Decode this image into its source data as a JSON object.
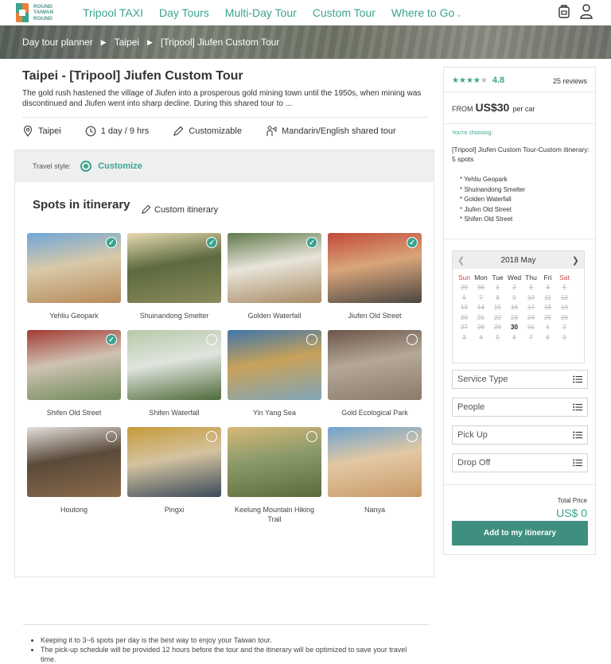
{
  "brand": {
    "logo_lines": [
      "ROUND",
      "TAIWAN",
      "ROUND"
    ]
  },
  "nav": {
    "links": [
      "Tripool TAXI",
      "Day Tours",
      "Multi-Day Tour",
      "Custom Tour",
      "Where to Go"
    ],
    "icons": [
      "backpack-icon",
      "user-icon"
    ]
  },
  "breadcrumb": [
    "Day tour planner",
    "Taipei",
    "[Tripool] Jiufen Custom Tour"
  ],
  "tour": {
    "title": "Taipei - [Tripool] Jiufen Custom Tour",
    "description": "The gold rush hastened the village of Jiufen into a prosperous gold mining town until the 1950s, when mining was discontinued and Jiufen went into sharp decline. During this shared tour to ...",
    "facts": {
      "location": "Taipei",
      "duration": "1 day / 9 hrs",
      "customizable": "Customizable",
      "language": "Mandarin/English shared tour"
    }
  },
  "travel_style": {
    "label": "Travel style:",
    "selected": "Customize"
  },
  "spots_section": {
    "title": "Spots in itinerary",
    "custom_link": "Custom itinerary"
  },
  "spots": [
    {
      "name": "Yehliu Geopark",
      "checked": true,
      "colors": [
        "#6fa6d8",
        "#b78a5a",
        "#d8c9a8"
      ]
    },
    {
      "name": "Shuinandong Smelter",
      "checked": true,
      "colors": [
        "#e8d9b0",
        "#8b8a5c",
        "#5c6a3f"
      ]
    },
    {
      "name": "Golden Waterfall",
      "checked": true,
      "colors": [
        "#5f7a4a",
        "#a78a62",
        "#e8e4da"
      ]
    },
    {
      "name": "Jiufen Old Street",
      "checked": true,
      "colors": [
        "#c24a3a",
        "#4a4642",
        "#d9a57a"
      ]
    },
    {
      "name": "Shifen Old Street",
      "checked": true,
      "colors": [
        "#a23a32",
        "#6f8a5a",
        "#cfc2b3"
      ]
    },
    {
      "name": "Shifen Waterfall",
      "checked": false,
      "colors": [
        "#b8c8a8",
        "#4f6a3a",
        "#dfe5de"
      ]
    },
    {
      "name": "Yin Yang Sea",
      "checked": false,
      "colors": [
        "#3f75a8",
        "#7fa5b8",
        "#c9a25a"
      ]
    },
    {
      "name": "Gold Ecological Park",
      "checked": false,
      "colors": [
        "#6a5548",
        "#8a7a6a",
        "#b5a898"
      ]
    },
    {
      "name": "Houtong",
      "checked": false,
      "colors": [
        "#e4e0dc",
        "#8a6a4a",
        "#5a4a3a"
      ]
    },
    {
      "name": "Pingxi",
      "checked": false,
      "colors": [
        "#c69a3a",
        "#3a4a5a",
        "#d4c3a0"
      ]
    },
    {
      "name": "Keelung Mountain Hiking Trail",
      "checked": false,
      "colors": [
        "#d8b878",
        "#5a6a3a",
        "#8a9a6a"
      ]
    },
    {
      "name": "Nanya",
      "checked": false,
      "colors": [
        "#6ea3cf",
        "#c99a6a",
        "#e3c8a3"
      ]
    }
  ],
  "notes": [
    "Keeping it to 3~6 spots per day is the best way to enjoy your Taiwan tour.",
    "The pick-up schedule will be provided 12 hours before the tour and the itinerary will be optimized to save your travel time."
  ],
  "booking": {
    "rating": 4.8,
    "rating_text": "4.8",
    "stars_filled": 4,
    "stars_total": 5,
    "reviews": "25 reviews",
    "from_label": "FROM",
    "price": "US$30",
    "per": "per car",
    "choosing_label": "You're choosing:",
    "choosing_text": "[Tripool] Jiufen Custom Tour-Custom itinerary: 5 spots",
    "chosen_spots": [
      "* Yehliu Geopark",
      "* Shuinandong Smelter",
      "* Golden Waterfall",
      "* Jiufen Old Street",
      "* Shifen Old Street"
    ],
    "calendar": {
      "title": "2018 May",
      "dow": [
        "Sun",
        "Mon",
        "Tue",
        "Wed",
        "Thu",
        "Fri",
        "Sat"
      ],
      "weeks": [
        [
          "29",
          "30",
          "1",
          "2",
          "3",
          "4",
          "5"
        ],
        [
          "6",
          "7",
          "8",
          "9",
          "10",
          "11",
          "12"
        ],
        [
          "13",
          "14",
          "15",
          "16",
          "17",
          "18",
          "19"
        ],
        [
          "20",
          "21",
          "22",
          "23",
          "24",
          "25",
          "26"
        ],
        [
          "27",
          "28",
          "29",
          "30",
          "31",
          "1",
          "2"
        ],
        [
          "3",
          "4",
          "5",
          "6",
          "7",
          "8",
          "9"
        ]
      ],
      "available": [
        "4-3"
      ]
    },
    "selects": [
      "Service Type",
      "People",
      "Pick Up",
      "Drop Off"
    ],
    "total_label": "Total Price",
    "total": "US$ 0",
    "add_button": "Add to my itinerary"
  },
  "colors": {
    "accent": "#3aa38f",
    "button": "#3f8f80",
    "weekend": "#d24545"
  }
}
